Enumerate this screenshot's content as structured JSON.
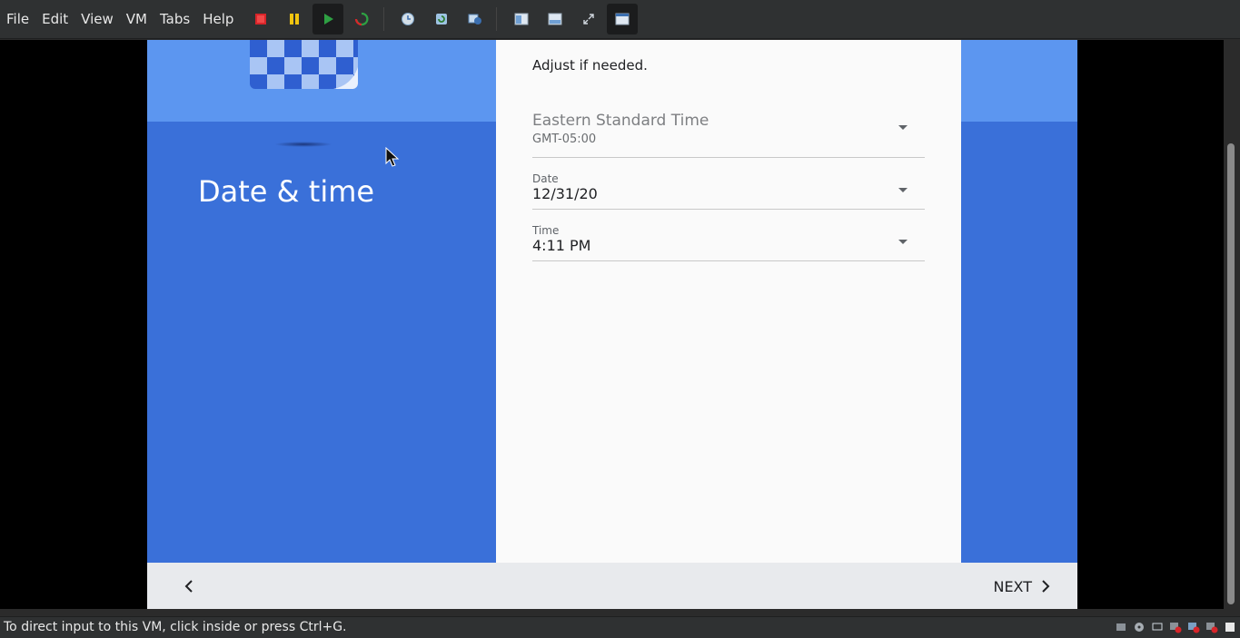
{
  "menubar": {
    "items": [
      "File",
      "Edit",
      "View",
      "VM",
      "Tabs",
      "Help"
    ]
  },
  "toolbar": {
    "icons": [
      "power-off-icon",
      "pause-icon",
      "play-icon",
      "reset-icon",
      "snapshot-icon",
      "revert-snapshot-icon",
      "snapshot-manager-icon",
      "quick-switch-icon",
      "unity-icon",
      "full-screen-icon",
      "console-view-icon"
    ]
  },
  "guest": {
    "title": "Date & time",
    "hint": "Adjust if needed.",
    "timezone": {
      "name": "Eastern Standard Time",
      "offset": "GMT-05:00"
    },
    "date": {
      "label": "Date",
      "value": "12/31/20"
    },
    "time": {
      "label": "Time",
      "value": "4:11 PM"
    },
    "next_label": "NEXT"
  },
  "status": {
    "text": "To direct input to this VM, click inside or press Ctrl+G."
  },
  "colors": {
    "blue_main": "#3a70d9",
    "blue_top": "#5c96f0",
    "card": "#fafafa",
    "footer": "#e8eaed"
  }
}
